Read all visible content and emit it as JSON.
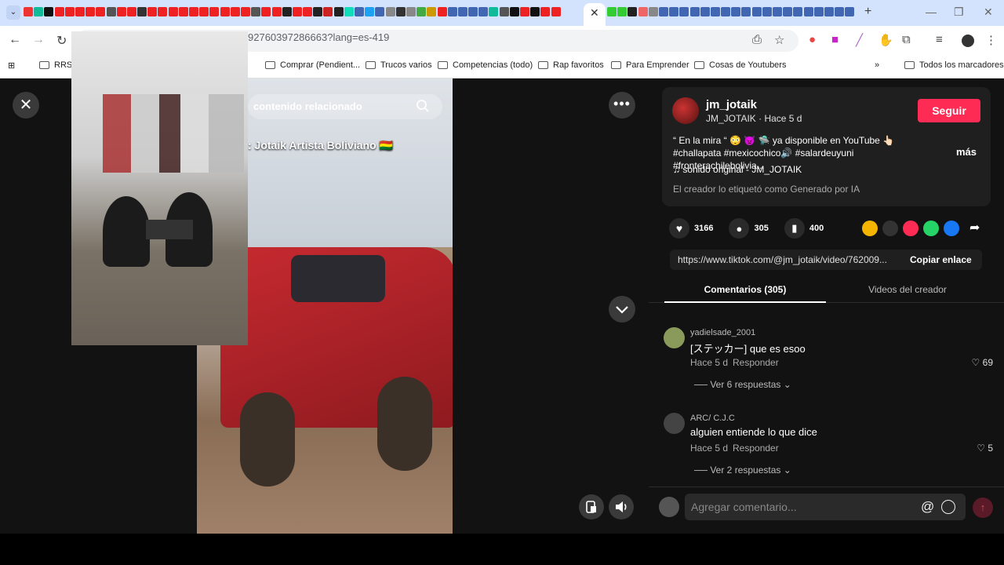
{
  "browser": {
    "url": "92760397286663?lang=es-419",
    "tab_colors": [
      "#e33",
      "#1b9",
      "#111",
      "#e22",
      "#e22",
      "#e22",
      "#e22",
      "#e22",
      "#555",
      "#e22",
      "#e22",
      "#333",
      "#e22",
      "#e22",
      "#e22",
      "#e22",
      "#e22",
      "#e22",
      "#e22",
      "#e22",
      "#e22",
      "#e22",
      "#555",
      "#e22",
      "#e22",
      "#222",
      "#e22",
      "#e22",
      "#222",
      "#c22",
      "#222",
      "#1db",
      "#4267b2",
      "#1da1f2",
      "#4267b2",
      "#888",
      "#333",
      "#888",
      "#4a4",
      "#c90",
      "#e22",
      "#4267b2",
      "#4267b2",
      "#4267b2",
      "#4267b2",
      "#1b9",
      "#555",
      "#111",
      "#e22",
      "#111",
      "#e22",
      "#e22"
    ],
    "tab_colors_right": [
      "#3c3",
      "#3c3",
      "#222",
      "#e66",
      "#888",
      "#4267b2",
      "#4267b2",
      "#4267b2",
      "#4267b2",
      "#4267b2",
      "#4267b2",
      "#4267b2",
      "#4267b2",
      "#4267b2",
      "#4267b2",
      "#4267b2",
      "#4267b2",
      "#4267b2",
      "#4267b2",
      "#4267b2",
      "#4267b2",
      "#4267b2",
      "#4267b2",
      "#4267b2"
    ],
    "bookmarks": [
      {
        "label": "RRSS"
      },
      {
        "label": "Comprar (Pendient..."
      },
      {
        "label": "Trucos varios"
      },
      {
        "label": "Competencias (todo)"
      },
      {
        "label": "Rap favoritos"
      },
      {
        "label": "Para Emprender"
      },
      {
        "label": "Cosas de Youtubers"
      }
    ],
    "overflow_label": "»",
    "all_bookmarks": "Todos los marcadores"
  },
  "video": {
    "search_placeholder": "contenido relacionado",
    "title": ": Jotaik Artista Boliviano 🇧🇴"
  },
  "creator": {
    "username": "jm_jotaik",
    "subline": "JM_JOTAIK · Hace 5 d",
    "follow_label": "Seguir",
    "description": "“ En la mira “ 😳 👿 🛸 ya disponible en YouTube 👆🏻#challapata #mexicochico🔊 #salardeuyuni #fronterachilebolivia...",
    "more_label": "más",
    "music": "♫  sonido original - JM_JOTAIK",
    "ai_label": "El creador lo etiquetó como Generado por IA"
  },
  "stats": {
    "likes": "3166",
    "comments": "305",
    "saves": "400"
  },
  "share": {
    "link": "https://www.tiktok.com/@jm_jotaik/video/762009...",
    "copy_label": "Copiar enlace",
    "colors": [
      "#f4b400",
      "#333",
      "#fe2c55",
      "#25d366",
      "#1877f2"
    ]
  },
  "tabs": {
    "comments_label": "Comentarios (305)",
    "creator_videos_label": "Videos del creador"
  },
  "comments": [
    {
      "user": "yadielsade_2001",
      "text": "[ステッカー] que es esoo",
      "time": "Hace 5 d",
      "reply": "Responder",
      "likes": "♡ 69",
      "more": "──  Ver 6 respuestas  ⌄",
      "avatar_color": "#8a9a5a"
    },
    {
      "user": "ARC/ C.J.C",
      "text": "alguien entiende lo que dice",
      "time": "Hace 5 d",
      "reply": "Responder",
      "likes": "♡ 5",
      "more": "──  Ver 2 respuestas  ⌄",
      "avatar_color": "#444"
    }
  ],
  "composer": {
    "placeholder": "Agregar comentario...",
    "at": "@",
    "send": "↑"
  }
}
